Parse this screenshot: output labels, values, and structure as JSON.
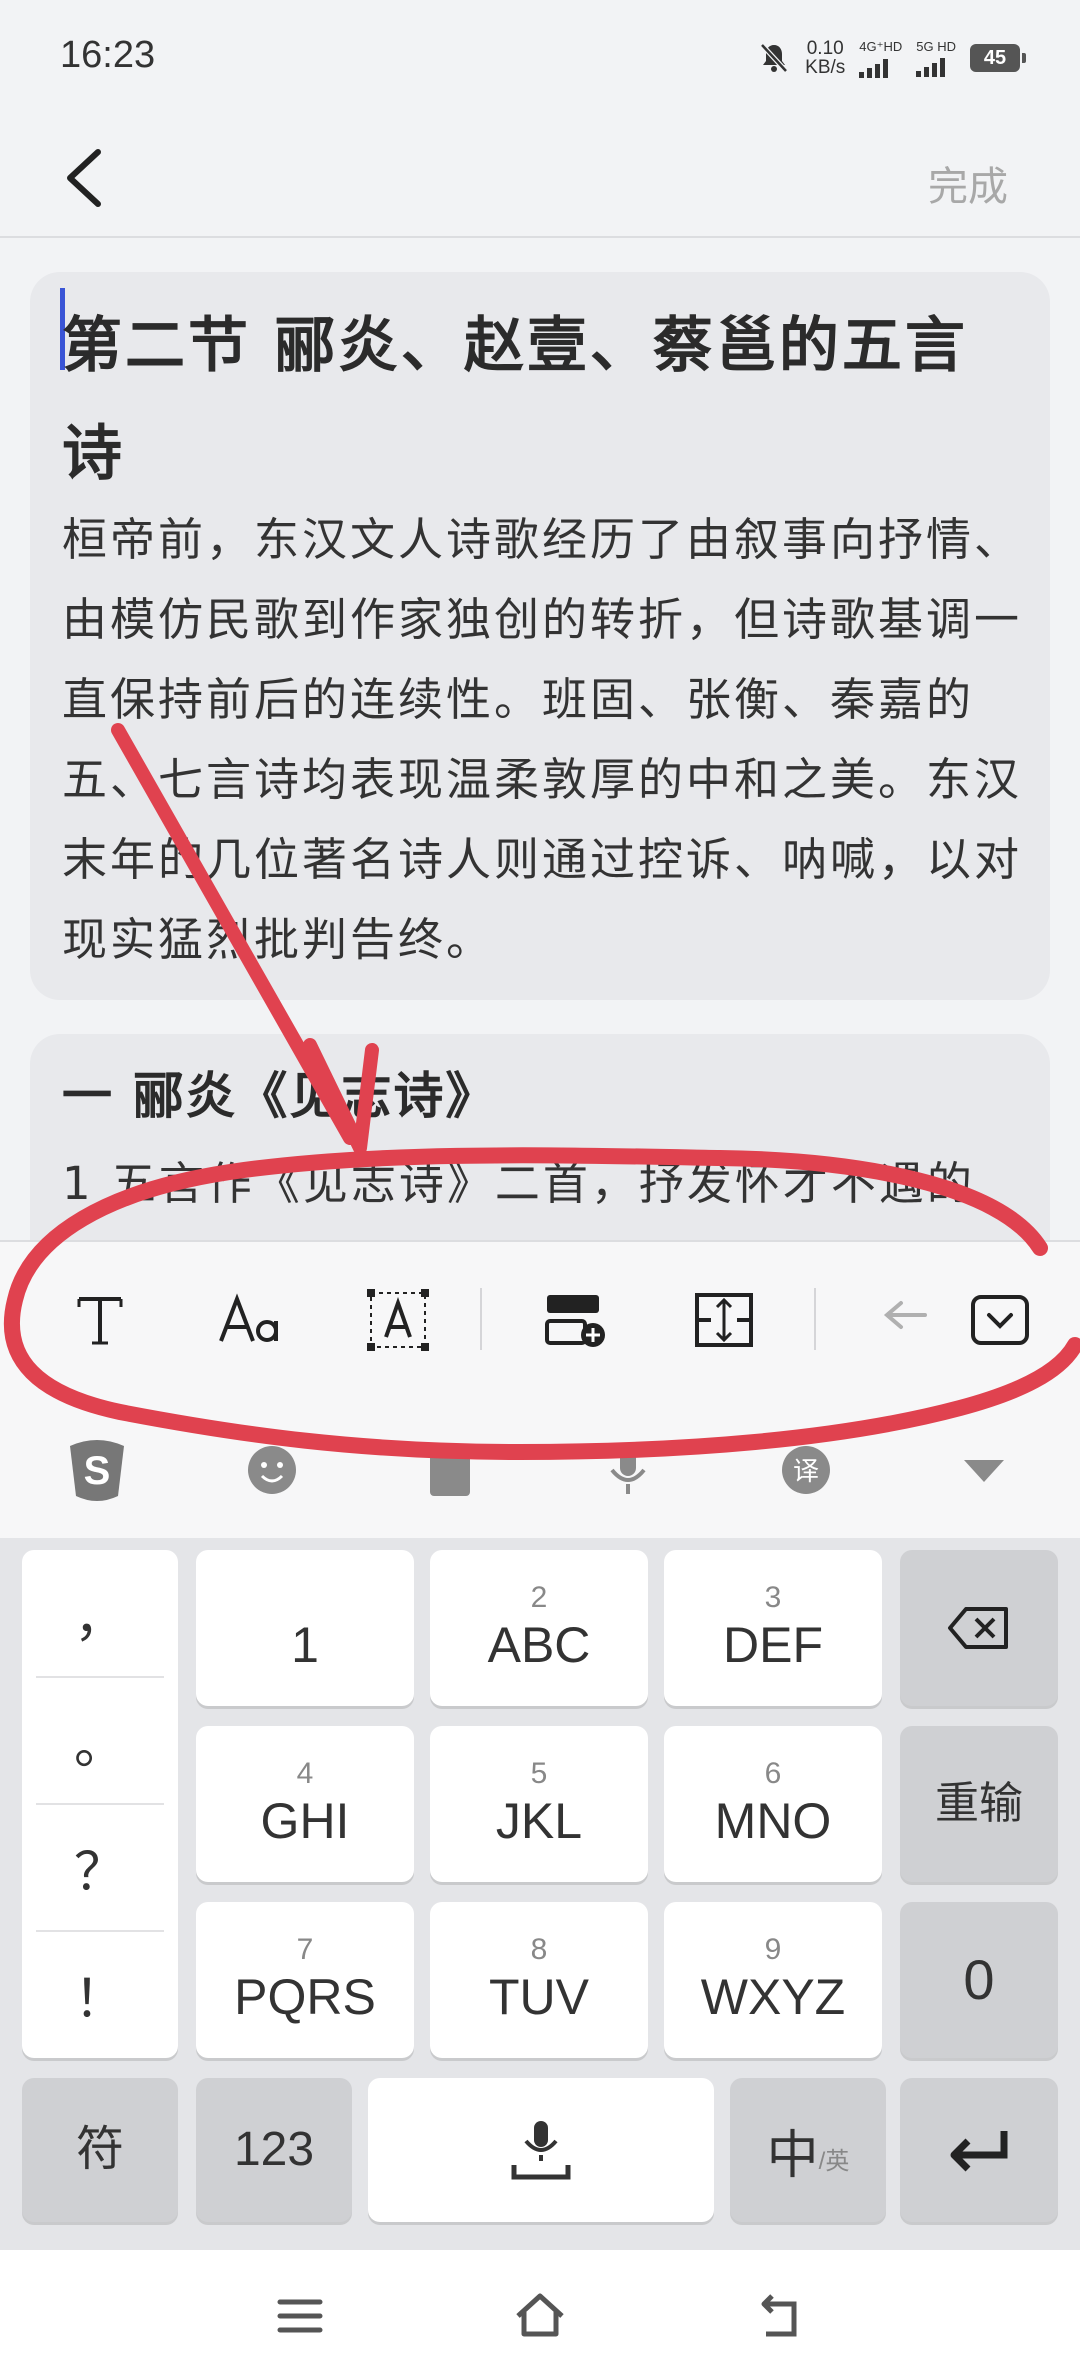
{
  "status_bar": {
    "time": "16:23",
    "net_speed_value": "0.10",
    "net_speed_unit": "KB/s",
    "sim1_label": "4G⁺HD",
    "sim2_label": "5G HD",
    "battery": "45",
    "icons": [
      "mute-bell-icon",
      "signal-icon",
      "battery-icon"
    ]
  },
  "header": {
    "back_icon": "chevron-left-icon",
    "done_label": "完成"
  },
  "document": {
    "section_title": "第二节 郦炎、赵壹、蔡邕的五言诗",
    "section_paragraph": "桓帝前，东汉文人诗歌经历了由叙事向抒情、由模仿民歌到作家独创的转折，但诗歌基调一直保持前后的连续性。班固、张衡、秦嘉的五、七言诗均表现温柔敦厚的中和之美。东汉末年的几位著名诗人则通过控诉、呐喊，以对现实猛烈批判告终。",
    "subsection_title": "一 郦炎《见志诗》",
    "subsection_paragraph": "1 五言作《见志诗》二首，抒发怀才不遇的"
  },
  "format_toolbar": {
    "tools": [
      "text-style-icon",
      "font-size-icon",
      "text-box-icon",
      "insert-block-icon",
      "spacing-icon",
      "undo-arrow-icon",
      "collapse-keyboard-icon"
    ]
  },
  "ime_bar": {
    "icons": [
      "sogou-logo-icon",
      "emoji-icon",
      "clipboard-icon",
      "microphone-icon",
      "translate-icon",
      "hide-keyboard-icon"
    ]
  },
  "keyboard": {
    "punctuation": [
      "，",
      "。",
      "？",
      "！"
    ],
    "keys": [
      {
        "num": "",
        "letters": "1"
      },
      {
        "num": "2",
        "letters": "ABC"
      },
      {
        "num": "3",
        "letters": "DEF"
      },
      {
        "num": "4",
        "letters": "GHI"
      },
      {
        "num": "5",
        "letters": "JKL"
      },
      {
        "num": "6",
        "letters": "MNO"
      },
      {
        "num": "7",
        "letters": "PQRS"
      },
      {
        "num": "8",
        "letters": "TUV"
      },
      {
        "num": "9",
        "letters": "WXYZ"
      }
    ],
    "backspace_icon": "backspace-icon",
    "reenter_label": "重输",
    "zero_label": "0",
    "symbols_label": "符",
    "numbers_label": "123",
    "space_icon": "mic-space-icon",
    "lang_main": "中",
    "lang_sub": "/英",
    "enter_icon": "enter-icon"
  },
  "nav_bar": {
    "icons": [
      "menu-icon",
      "home-icon",
      "back-icon"
    ]
  },
  "colors": {
    "accent_cursor": "#3a55d6",
    "annotation_red": "#e0424f",
    "done_inactive": "#a8a8a8"
  }
}
